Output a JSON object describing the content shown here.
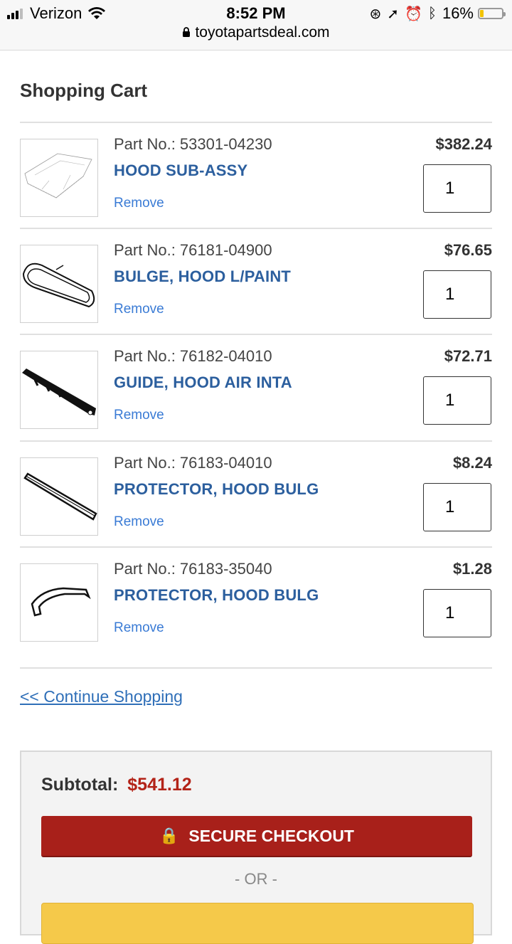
{
  "status_bar": {
    "carrier": "Verizon",
    "time": "8:52 PM",
    "battery_percent": "16%",
    "battery_level": 0.16,
    "url": "toyotapartsdeal.com",
    "icons": [
      "signal-icon",
      "wifi-icon",
      "rotation-lock-icon",
      "location-icon",
      "alarm-icon",
      "bluetooth-icon",
      "battery-icon",
      "lock-icon"
    ]
  },
  "page": {
    "title": "Shopping Cart"
  },
  "cart": {
    "remove_label": "Remove",
    "items": [
      {
        "part_no": "Part No.: 53301-04230",
        "name": "HOOD SUB-ASSY",
        "price": "$382.24",
        "qty": "1",
        "icon": "hood-part-image"
      },
      {
        "part_no": "Part No.: 76181-04900",
        "name": "BULGE, HOOD L/PAINT",
        "price": "$76.65",
        "qty": "1",
        "icon": "hood-bulge-part-image"
      },
      {
        "part_no": "Part No.: 76182-04010",
        "name": "GUIDE, HOOD AIR INTA",
        "price": "$72.71",
        "qty": "1",
        "icon": "air-intake-guide-part-image"
      },
      {
        "part_no": "Part No.: 76183-04010",
        "name": "PROTECTOR, HOOD BULG",
        "price": "$8.24",
        "qty": "1",
        "icon": "protector-strip-part-image"
      },
      {
        "part_no": "Part No.: 76183-35040",
        "name": "PROTECTOR, HOOD BULG",
        "price": "$1.28",
        "qty": "1",
        "icon": "protector-bracket-part-image"
      }
    ]
  },
  "continue_shopping": "<< Continue Shopping",
  "summary": {
    "subtotal_label": "Subtotal:",
    "subtotal_value": "$541.12",
    "checkout_label": "SECURE CHECKOUT",
    "or_label": "- OR -"
  },
  "colors": {
    "link_blue": "#2c5f9e",
    "checkout_red": "#a8201a",
    "subtotal_red": "#b32318",
    "alt_button_yellow": "#f5c94a"
  }
}
